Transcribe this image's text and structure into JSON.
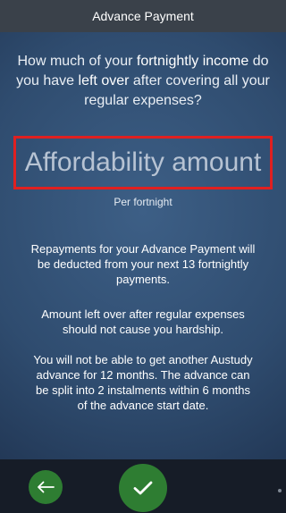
{
  "titlebar": {
    "title": "Advance Payment"
  },
  "question": {
    "line1_a": "How much of your ",
    "line1_b": "fortnightly income",
    "line1_c": " do",
    "line2_a": "you have ",
    "line2_b": "left over",
    "line2_c": " after covering all your",
    "line3": "regular expenses?"
  },
  "amount_field": {
    "placeholder": "Affordability amount",
    "value": ""
  },
  "per_label": "Per fortnight",
  "info": {
    "p1": [
      "Repayments for your Advance Payment will",
      "be deducted from your next 13 fortnightly",
      "payments."
    ],
    "p2": [
      "Amount left over after regular expenses",
      "should not cause you hardship."
    ],
    "p3": [
      "You will not be able to get another Austudy",
      "advance for 12 months. The advance can",
      "be split into 2 instalments within 6 months",
      "of the advance start date."
    ]
  },
  "icons": {
    "back": "arrow-left-icon",
    "confirm": "checkmark-icon"
  },
  "colors": {
    "accent_green": "#2e7d32",
    "field_border": "#e02020"
  }
}
